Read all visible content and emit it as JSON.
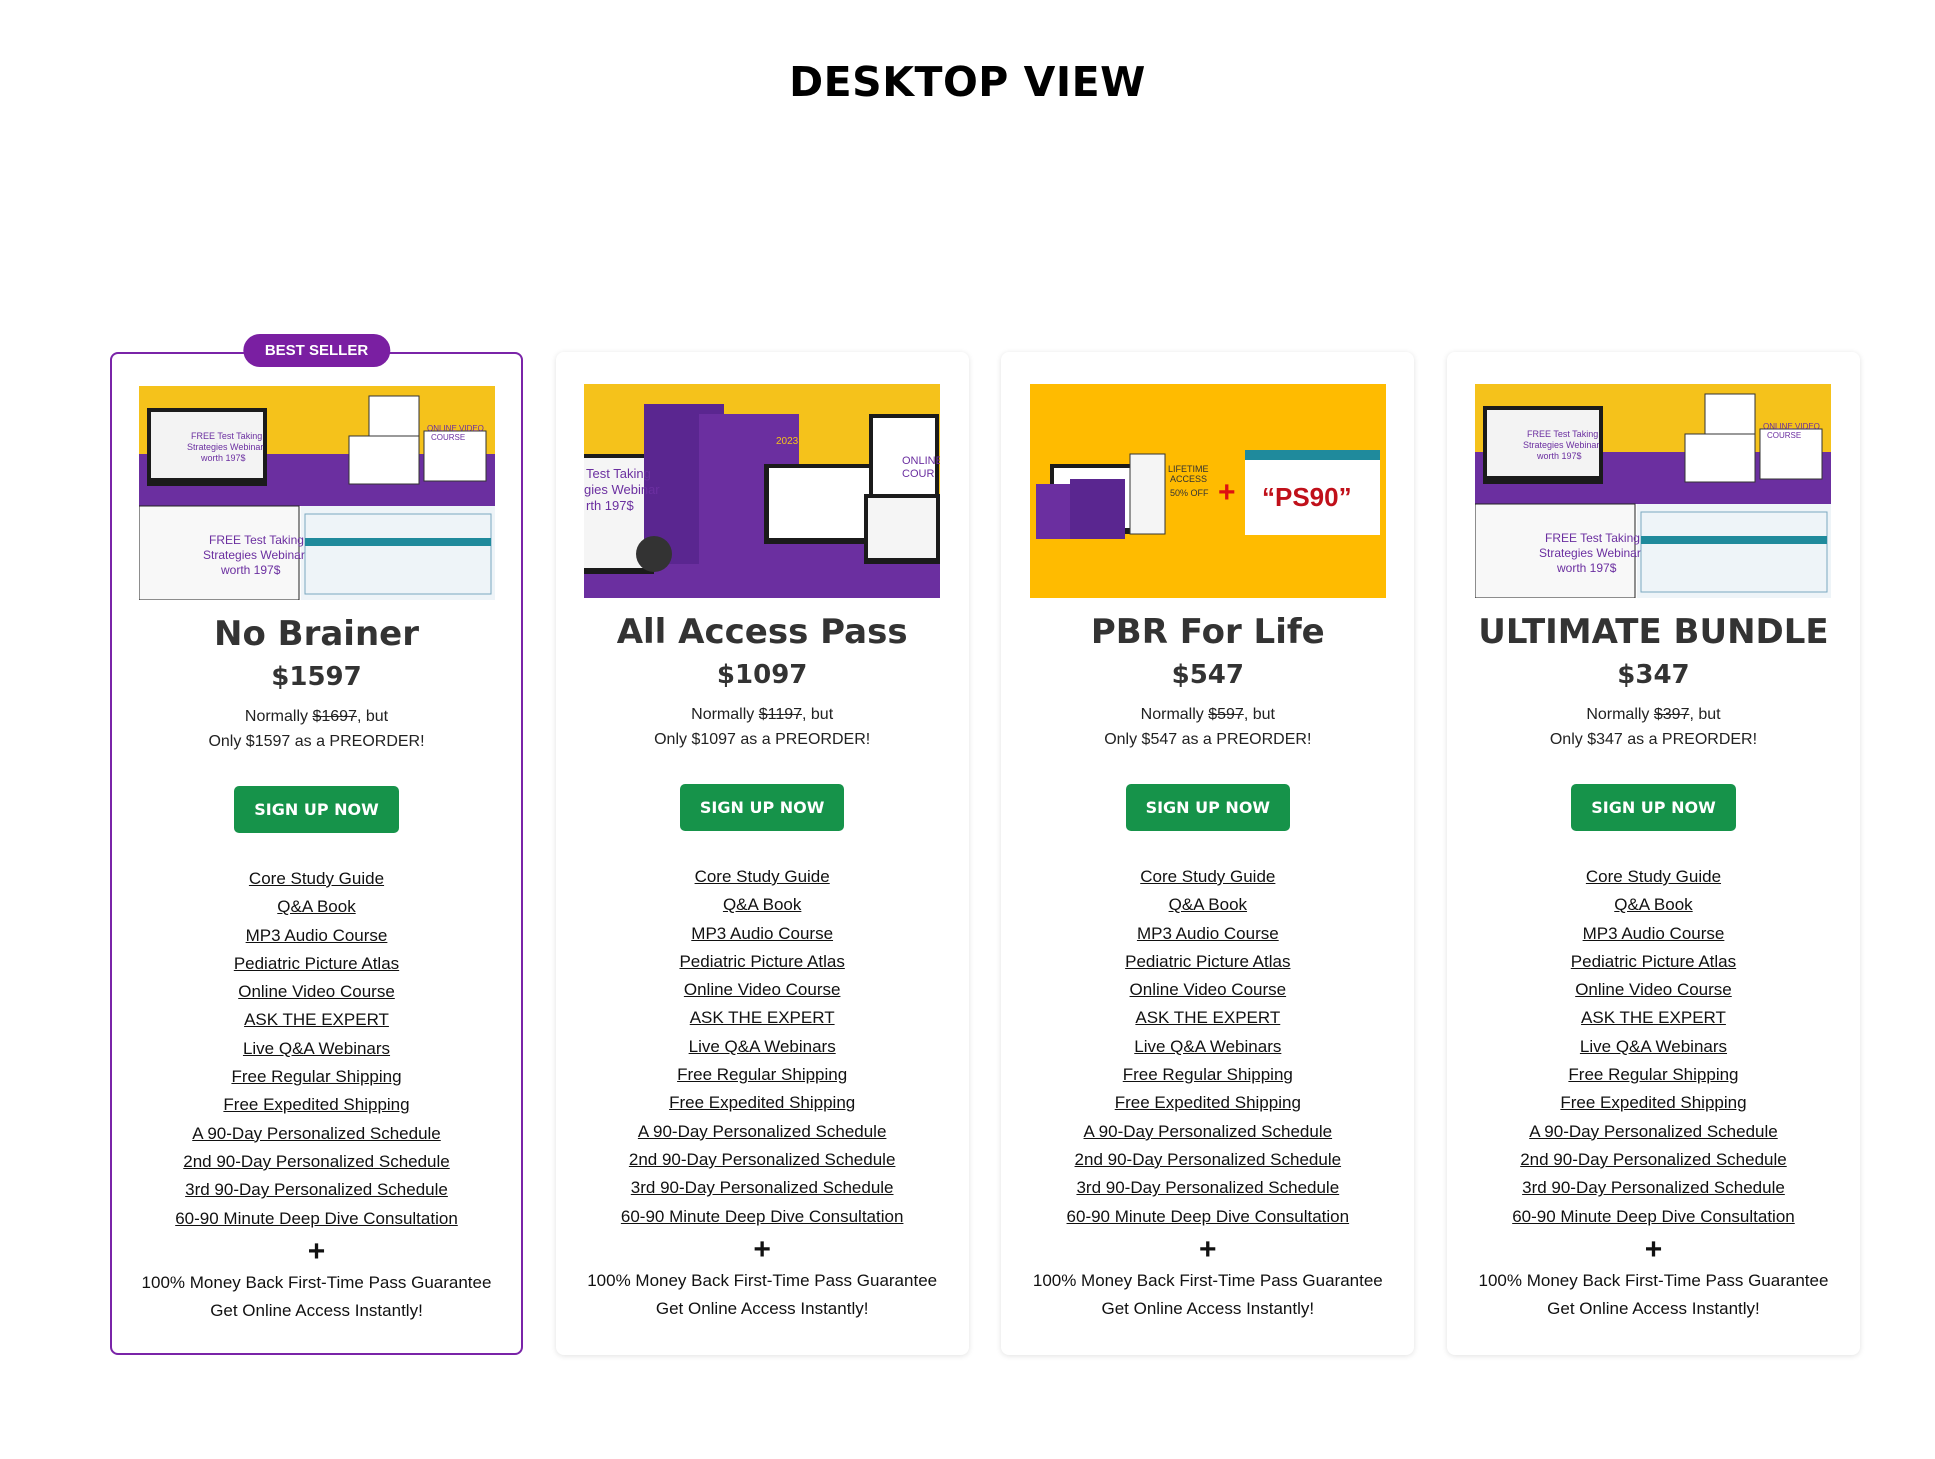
{
  "page": {
    "title": "DESKTOP VIEW"
  },
  "plans": [
    {
      "badge": "BEST SELLER",
      "name": "No Brainer",
      "price": "$1597",
      "normally_prefix": "Normally ",
      "normal_price": "$1697",
      "normally_suffix": ", but",
      "preorder_note": "Only $1597 as a PREORDER!",
      "cta": "SIGN UP NOW",
      "features": [
        "Core Study Guide",
        "Q&A Book",
        "MP3 Audio Course ",
        "Pediatric Picture Atlas",
        "Online Video Course",
        "ASK THE EXPERT",
        "Live Q&A Webinars",
        "Free Regular Shipping",
        "Free Expedited Shipping",
        "A 90-Day Personalized Schedule",
        "2nd 90-Day Personalized Schedule",
        "3rd 90-Day Personalized Schedule",
        "60-90 Minute Deep Dive Consultation"
      ],
      "plus": "+",
      "guarantee": "100% Money Back First-Time Pass Guarantee",
      "access": "Get Online Access Instantly!",
      "image_text": [
        "FREE Test Taking",
        "Strategies Webinar",
        "worth 197$",
        "ONLINE VIDEO",
        "COURSE"
      ]
    },
    {
      "name": "All Access Pass",
      "price": "$1097",
      "normally_prefix": "Normally ",
      "normal_price": "$1197",
      "normally_suffix": ", but",
      "preorder_note": "Only $1097 as a PREORDER!",
      "cta": "SIGN UP NOW",
      "features": [
        "Core Study Guide",
        "Q&A Book",
        "MP3 Audio Course ",
        "Pediatric Picture Atlas",
        "Online Video Course",
        "ASK THE EXPERT",
        "Live Q&A Webinars",
        "Free Regular Shipping",
        "Free Expedited Shipping",
        "A 90-Day Personalized Schedule",
        "2nd 90-Day Personalized Schedule",
        "3rd 90-Day Personalized Schedule",
        "60-90 Minute Deep Dive Consultation"
      ],
      "plus": "+",
      "guarantee": "100% Money Back First-Time Pass Guarantee",
      "access": "Get Online Access Instantly!",
      "image_text": [
        "Test Taking",
        "gies Webinar",
        "rth 197$",
        "2023",
        "ONLINE V",
        "COUR"
      ]
    },
    {
      "name": "PBR For Life",
      "price": "$547",
      "normally_prefix": "Normally ",
      "normal_price": "$597",
      "normally_suffix": ", but",
      "preorder_note": "Only $547 as a PREORDER!",
      "cta": "SIGN UP NOW",
      "features": [
        "Core Study Guide",
        "Q&A Book",
        "MP3 Audio Course ",
        "Pediatric Picture Atlas",
        "Online Video Course",
        "ASK THE EXPERT",
        "Live Q&A Webinars",
        "Free Regular Shipping",
        "Free Expedited Shipping",
        "A 90-Day Personalized Schedule",
        "2nd 90-Day Personalized Schedule",
        "3rd 90-Day Personalized Schedule",
        "60-90 Minute Deep Dive Consultation"
      ],
      "plus": "+",
      "guarantee": "100% Money Back First-Time Pass Guarantee",
      "access": "Get Online Access Instantly!",
      "image_text": [
        "LIFETIME",
        "ACCESS",
        "50% OFF",
        "+",
        "“PS90”"
      ]
    },
    {
      "name": "ULTIMATE BUNDLE",
      "price": "$347",
      "normally_prefix": "Normally ",
      "normal_price": "$397",
      "normally_suffix": ", but",
      "preorder_note": "Only $347 as a PREORDER!",
      "cta": "SIGN UP NOW",
      "features": [
        "Core Study Guide",
        "Q&A Book",
        "MP3 Audio Course ",
        "Pediatric Picture Atlas",
        "Online Video Course",
        "ASK THE EXPERT",
        "Live Q&A Webinars",
        "Free Regular Shipping",
        "Free Expedited Shipping",
        "A 90-Day Personalized Schedule",
        "2nd 90-Day Personalized Schedule",
        "3rd 90-Day Personalized Schedule",
        "60-90 Minute Deep Dive Consultation"
      ],
      "plus": "+",
      "guarantee": "100% Money Back First-Time Pass Guarantee",
      "access": "Get Online Access Instantly!",
      "image_text": [
        "FREE Test Taking",
        "Strategies Webinar",
        "worth 197$",
        "ONLINE VIDEO",
        "COURSE"
      ]
    }
  ],
  "colors": {
    "purple": "#7a1fa2",
    "green": "#16934a",
    "yellow": "#f5c21b",
    "banner_purple": "#6b2fa0"
  }
}
